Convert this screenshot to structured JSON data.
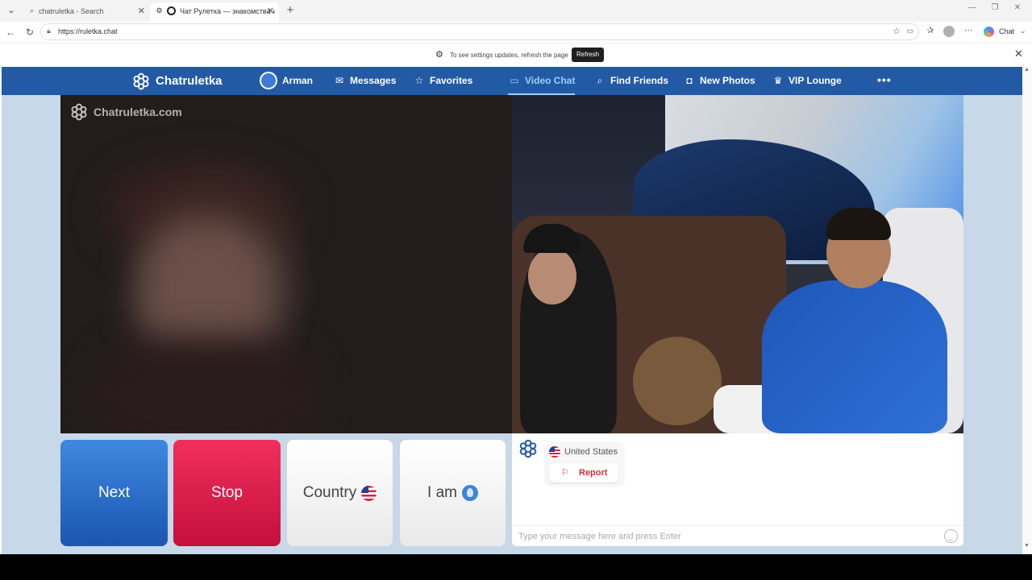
{
  "browser": {
    "tabs": [
      {
        "title": "chatruletka - Search"
      },
      {
        "title": "Чат Рулетка — знакомства и"
      }
    ],
    "url": "https://ruletka.chat",
    "profile_chat_label": "Chat",
    "infobar": {
      "message": "To see settings updates, refresh the page",
      "refresh_label": "Refresh"
    }
  },
  "site": {
    "brand": "Chatruletka",
    "nav": [
      {
        "label": "Arman",
        "icon": "user-avatar-icon"
      },
      {
        "label": "Messages",
        "icon": "envelope-icon"
      },
      {
        "label": "Favorites",
        "icon": "star-icon"
      },
      {
        "label": "Video Chat",
        "icon": "video-camera-icon",
        "active": true
      },
      {
        "label": "Find Friends",
        "icon": "search-icon"
      },
      {
        "label": "New Photos",
        "icon": "camera-icon"
      },
      {
        "label": "VIP Lounge",
        "icon": "crown-icon"
      }
    ],
    "more_label": "•••",
    "colors": {
      "nav_bg": "#235aa6",
      "page_bg": "#c7d8e8",
      "next": "#2567c4",
      "stop": "#e01f4b",
      "report": "#d32f3a"
    }
  },
  "video": {
    "watermark": "Chatruletka.com"
  },
  "controls": {
    "next_label": "Next",
    "stop_label": "Stop",
    "country_label": "Country",
    "iam_label": "I am"
  },
  "chat": {
    "country": "United States",
    "report_label": "Report",
    "input_placeholder": "Type your message here and press Enter"
  }
}
